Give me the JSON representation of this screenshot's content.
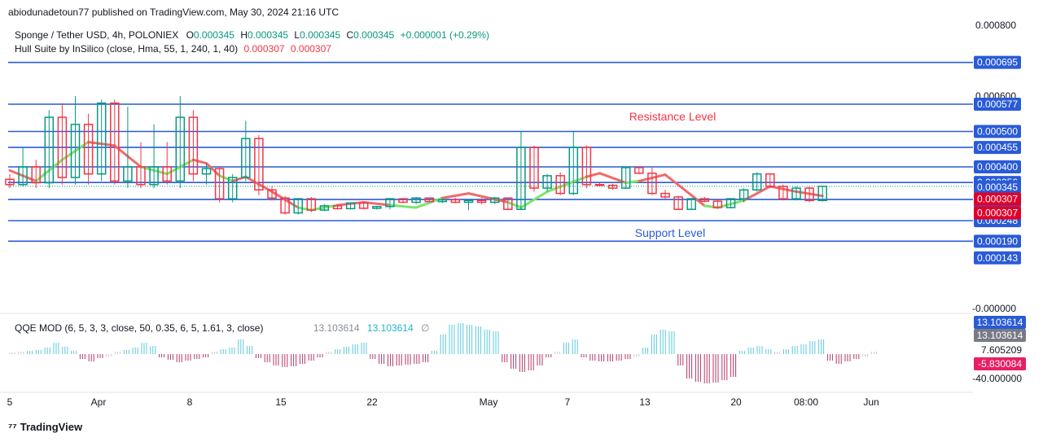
{
  "publisher": "abiodunadetoun77 published on TradingView.com, May 30, 2024 21:16 UTC",
  "legend": {
    "symbol": "Sponge / Tether USD, 4h, POLONIEX",
    "o_label": "O",
    "o_value": "0.000345",
    "h_label": "H",
    "h_value": "0.000345",
    "l_label": "L",
    "l_value": "0.000345",
    "c_label": "C",
    "c_value": "0.000345",
    "change": "+0.000001 (+0.29%)",
    "hull_label": "Hull Suite by InSilico (close, Hma, 55, 1, 240, 1, 40)",
    "hull_v1": "0.000307",
    "hull_v2": "0.000307"
  },
  "qqe_legend": {
    "label": "QQE MOD (6, 5, 3, 3, close, 50, 0.35, 6, 5, 1.61, 3, close)",
    "v1": "13.103614",
    "v2": "13.103614",
    "empty": "∅"
  },
  "annotations": {
    "resistance": "Resistance Level",
    "support": "Support Level"
  },
  "colors": {
    "up": "#089981",
    "down": "#f23645",
    "hull_up": "#7ee36b",
    "hull_down": "#f06a6a",
    "level_line": "#2a5bd7",
    "label_blue": "#2a5bd7",
    "label_red": "#e0002a",
    "qqe_up": "#5cc8de",
    "qqe_down": "#b5376b",
    "qqe_neutral": "#c8c8c8"
  },
  "brand": "TradingView",
  "chart_data": [
    {
      "type": "candlestick",
      "price_axis": {
        "ticks": [
          "0.000800",
          "0.000600",
          "-0.000000"
        ],
        "tick_values": [
          0.0008,
          0.0006,
          0.0
        ]
      },
      "levels": [
        {
          "value": 0.000695,
          "label": "0.000695"
        },
        {
          "value": 0.000577,
          "label": "0.000577"
        },
        {
          "value": 0.0005,
          "label": "0.000500"
        },
        {
          "value": 0.000455,
          "label": "0.000455"
        },
        {
          "value": 0.0004,
          "label": "0.000400"
        },
        {
          "value": 0.000356,
          "label": "0.000356"
        },
        {
          "value": 0.000308,
          "label": "0.000308"
        },
        {
          "value": 0.000248,
          "label": "0.000248"
        },
        {
          "value": 0.00019,
          "label": "0.000190"
        }
      ],
      "extra_labels": [
        {
          "value": 0.000143,
          "label": "0.000143",
          "kind": "blue"
        },
        {
          "value": 0.000345,
          "label": "0.000345",
          "kind": "blue"
        },
        {
          "value": 0.000307,
          "label": "0.000307",
          "kind": "red"
        },
        {
          "value": 0.000307,
          "label": "0.000307",
          "kind": "red"
        }
      ],
      "time_axis": {
        "labels": [
          "5",
          "Apr",
          "8",
          "15",
          "22",
          "May",
          "7",
          "13",
          "20",
          "08:00",
          "Jun"
        ],
        "x": [
          0,
          6,
          13,
          20,
          27,
          36,
          43,
          49,
          56,
          62,
          68
        ]
      },
      "candles": [
        {
          "t": 0,
          "o": 0.000365,
          "h": 0.00038,
          "l": 0.00034,
          "c": 0.00035
        },
        {
          "t": 1,
          "o": 0.00035,
          "h": 0.000455,
          "l": 0.000345,
          "c": 0.0004
        },
        {
          "t": 2,
          "o": 0.0004,
          "h": 0.00042,
          "l": 0.00034,
          "c": 0.000355
        },
        {
          "t": 3,
          "o": 0.000355,
          "h": 0.00056,
          "l": 0.00034,
          "c": 0.00054
        },
        {
          "t": 4,
          "o": 0.00054,
          "h": 0.00058,
          "l": 0.00035,
          "c": 0.00037
        },
        {
          "t": 5,
          "o": 0.00037,
          "h": 0.0006,
          "l": 0.00035,
          "c": 0.00052
        },
        {
          "t": 6,
          "o": 0.00052,
          "h": 0.00055,
          "l": 0.00035,
          "c": 0.00038
        },
        {
          "t": 7,
          "o": 0.00038,
          "h": 0.00059,
          "l": 0.00036,
          "c": 0.00058
        },
        {
          "t": 8,
          "o": 0.00058,
          "h": 0.00059,
          "l": 0.00035,
          "c": 0.00036
        },
        {
          "t": 9,
          "o": 0.00036,
          "h": 0.00057,
          "l": 0.00034,
          "c": 0.0004
        },
        {
          "t": 10,
          "o": 0.0004,
          "h": 0.00047,
          "l": 0.00034,
          "c": 0.00035
        },
        {
          "t": 11,
          "o": 0.00035,
          "h": 0.00052,
          "l": 0.00034,
          "c": 0.0004
        },
        {
          "t": 12,
          "o": 0.0004,
          "h": 0.00047,
          "l": 0.00035,
          "c": 0.00036
        },
        {
          "t": 13,
          "o": 0.00036,
          "h": 0.0006,
          "l": 0.00034,
          "c": 0.00054
        },
        {
          "t": 14,
          "o": 0.00054,
          "h": 0.00056,
          "l": 0.00036,
          "c": 0.00038
        },
        {
          "t": 15,
          "o": 0.00038,
          "h": 0.00041,
          "l": 0.00035,
          "c": 0.000395
        },
        {
          "t": 16,
          "o": 0.000395,
          "h": 0.0004,
          "l": 0.0003,
          "c": 0.00031
        },
        {
          "t": 17,
          "o": 0.00031,
          "h": 0.00038,
          "l": 0.0003,
          "c": 0.00037
        },
        {
          "t": 18,
          "o": 0.00037,
          "h": 0.00053,
          "l": 0.00036,
          "c": 0.00048
        },
        {
          "t": 19,
          "o": 0.00048,
          "h": 0.00049,
          "l": 0.00032,
          "c": 0.000335
        },
        {
          "t": 20,
          "o": 0.000335,
          "h": 0.000345,
          "l": 0.000305,
          "c": 0.000312
        },
        {
          "t": 21,
          "o": 0.000312,
          "h": 0.000318,
          "l": 0.000265,
          "c": 0.00027
        },
        {
          "t": 22,
          "o": 0.00027,
          "h": 0.000312,
          "l": 0.000265,
          "c": 0.00031
        },
        {
          "t": 23,
          "o": 0.00031,
          "h": 0.000315,
          "l": 0.000272,
          "c": 0.000278
        },
        {
          "t": 24,
          "o": 0.000278,
          "h": 0.000295,
          "l": 0.000275,
          "c": 0.00029
        },
        {
          "t": 25,
          "o": 0.00029,
          "h": 0.000295,
          "l": 0.00028,
          "c": 0.000282
        },
        {
          "t": 26,
          "o": 0.000282,
          "h": 0.0003,
          "l": 0.00028,
          "c": 0.000298
        },
        {
          "t": 27,
          "o": 0.000298,
          "h": 0.000302,
          "l": 0.00028,
          "c": 0.000283
        },
        {
          "t": 28,
          "o": 0.000283,
          "h": 0.00029,
          "l": 0.00028,
          "c": 0.000288
        },
        {
          "t": 29,
          "o": 0.000288,
          "h": 0.000312,
          "l": 0.00028,
          "c": 0.00031
        },
        {
          "t": 30,
          "o": 0.00031,
          "h": 0.000312,
          "l": 0.000298,
          "c": 0.0003
        },
        {
          "t": 31,
          "o": 0.0003,
          "h": 0.000315,
          "l": 0.000295,
          "c": 0.000312
        },
        {
          "t": 32,
          "o": 0.000312,
          "h": 0.000313,
          "l": 0.0003,
          "c": 0.000302
        },
        {
          "t": 33,
          "o": 0.000302,
          "h": 0.00031,
          "l": 0.000298,
          "c": 0.000307
        },
        {
          "t": 34,
          "o": 0.000307,
          "h": 0.000312,
          "l": 0.000298,
          "c": 0.0003
        },
        {
          "t": 35,
          "o": 0.0003,
          "h": 0.00031,
          "l": 0.000278,
          "c": 0.000305
        },
        {
          "t": 36,
          "o": 0.000305,
          "h": 0.000312,
          "l": 0.000295,
          "c": 0.0003
        },
        {
          "t": 37,
          "o": 0.0003,
          "h": 0.000315,
          "l": 0.000295,
          "c": 0.000312
        },
        {
          "t": 38,
          "o": 0.000312,
          "h": 0.000314,
          "l": 0.000278,
          "c": 0.00028
        },
        {
          "t": 39,
          "o": 0.00028,
          "h": 0.0005,
          "l": 0.000278,
          "c": 0.000455
        },
        {
          "t": 40,
          "o": 0.000455,
          "h": 0.00046,
          "l": 0.00033,
          "c": 0.00034
        },
        {
          "t": 41,
          "o": 0.00034,
          "h": 0.00038,
          "l": 0.00033,
          "c": 0.000375
        },
        {
          "t": 42,
          "o": 0.000375,
          "h": 0.000385,
          "l": 0.00032,
          "c": 0.000325
        },
        {
          "t": 43,
          "o": 0.000325,
          "h": 0.0005,
          "l": 0.00032,
          "c": 0.000455
        },
        {
          "t": 44,
          "o": 0.000455,
          "h": 0.00046,
          "l": 0.00034,
          "c": 0.00035
        },
        {
          "t": 45,
          "o": 0.00035,
          "h": 0.000355,
          "l": 0.000345,
          "c": 0.000348
        },
        {
          "t": 46,
          "o": 0.000348,
          "h": 0.000352,
          "l": 0.000335,
          "c": 0.00034
        },
        {
          "t": 47,
          "o": 0.00034,
          "h": 0.0004,
          "l": 0.000338,
          "c": 0.000398
        },
        {
          "t": 48,
          "o": 0.000398,
          "h": 0.0004,
          "l": 0.00038,
          "c": 0.000382
        },
        {
          "t": 49,
          "o": 0.000382,
          "h": 0.000398,
          "l": 0.00032,
          "c": 0.000325
        },
        {
          "t": 50,
          "o": 0.000325,
          "h": 0.000335,
          "l": 0.00031,
          "c": 0.000315
        },
        {
          "t": 51,
          "o": 0.000315,
          "h": 0.000318,
          "l": 0.000278,
          "c": 0.00028
        },
        {
          "t": 52,
          "o": 0.00028,
          "h": 0.000312,
          "l": 0.000278,
          "c": 0.00031
        },
        {
          "t": 53,
          "o": 0.00031,
          "h": 0.000315,
          "l": 0.0003,
          "c": 0.000303
        },
        {
          "t": 54,
          "o": 0.000303,
          "h": 0.00031,
          "l": 0.000282,
          "c": 0.000285
        },
        {
          "t": 55,
          "o": 0.000285,
          "h": 0.000312,
          "l": 0.000283,
          "c": 0.00031
        },
        {
          "t": 56,
          "o": 0.00031,
          "h": 0.00034,
          "l": 0.0003,
          "c": 0.000335
        },
        {
          "t": 57,
          "o": 0.000335,
          "h": 0.000385,
          "l": 0.00033,
          "c": 0.00038
        },
        {
          "t": 58,
          "o": 0.00038,
          "h": 0.000382,
          "l": 0.00034,
          "c": 0.000345
        },
        {
          "t": 59,
          "o": 0.000345,
          "h": 0.00035,
          "l": 0.000305,
          "c": 0.00031
        },
        {
          "t": 60,
          "o": 0.00031,
          "h": 0.000345,
          "l": 0.000305,
          "c": 0.00034
        },
        {
          "t": 61,
          "o": 0.00034,
          "h": 0.000345,
          "l": 0.0003,
          "c": 0.000305
        },
        {
          "t": 62,
          "o": 0.000305,
          "h": 0.000345,
          "l": 0.000302,
          "c": 0.000345
        }
      ],
      "hull_line": [
        {
          "t": 0,
          "v": 0.00039,
          "trend": "down"
        },
        {
          "t": 2,
          "v": 0.00036,
          "trend": "down"
        },
        {
          "t": 4,
          "v": 0.00042,
          "trend": "up"
        },
        {
          "t": 6,
          "v": 0.00047,
          "trend": "up"
        },
        {
          "t": 8,
          "v": 0.00046,
          "trend": "down"
        },
        {
          "t": 10,
          "v": 0.0004,
          "trend": "down"
        },
        {
          "t": 12,
          "v": 0.00038,
          "trend": "up"
        },
        {
          "t": 14,
          "v": 0.00042,
          "trend": "up"
        },
        {
          "t": 15,
          "v": 0.00041,
          "trend": "down"
        },
        {
          "t": 16,
          "v": 0.000375,
          "trend": "down"
        },
        {
          "t": 17,
          "v": 0.00036,
          "trend": "up"
        },
        {
          "t": 18,
          "v": 0.000372,
          "trend": "down"
        },
        {
          "t": 20,
          "v": 0.00033,
          "trend": "down"
        },
        {
          "t": 22,
          "v": 0.000285,
          "trend": "down"
        },
        {
          "t": 23,
          "v": 0.000278,
          "trend": "up"
        },
        {
          "t": 25,
          "v": 0.000292,
          "trend": "up"
        },
        {
          "t": 27,
          "v": 0.0003,
          "trend": "down"
        },
        {
          "t": 29,
          "v": 0.000292,
          "trend": "down"
        },
        {
          "t": 31,
          "v": 0.000285,
          "trend": "up"
        },
        {
          "t": 33,
          "v": 0.000312,
          "trend": "up"
        },
        {
          "t": 35,
          "v": 0.000325,
          "trend": "down"
        },
        {
          "t": 38,
          "v": 0.0003,
          "trend": "down"
        },
        {
          "t": 39,
          "v": 0.000285,
          "trend": "up"
        },
        {
          "t": 41,
          "v": 0.00033,
          "trend": "up"
        },
        {
          "t": 44,
          "v": 0.000372,
          "trend": "up"
        },
        {
          "t": 45,
          "v": 0.000382,
          "trend": "down"
        },
        {
          "t": 47,
          "v": 0.000355,
          "trend": "down"
        },
        {
          "t": 48,
          "v": 0.00036,
          "trend": "up"
        },
        {
          "t": 50,
          "v": 0.000378,
          "trend": "down"
        },
        {
          "t": 52,
          "v": 0.00032,
          "trend": "down"
        },
        {
          "t": 53,
          "v": 0.00029,
          "trend": "down"
        },
        {
          "t": 54,
          "v": 0.000285,
          "trend": "up"
        },
        {
          "t": 56,
          "v": 0.000305,
          "trend": "up"
        },
        {
          "t": 58,
          "v": 0.000345,
          "trend": "down"
        },
        {
          "t": 60,
          "v": 0.00033,
          "trend": "down"
        },
        {
          "t": 62,
          "v": 0.000318,
          "trend": "down"
        }
      ]
    },
    {
      "type": "bar",
      "name": "QQE MOD",
      "y_ticks": [
        "13.103614",
        "13.103614",
        "7.605209",
        "-5.830084",
        "-40.000000"
      ],
      "tick_kinds": [
        "blue",
        "gray",
        "plain",
        "red",
        "plain"
      ],
      "values": [
        2,
        3,
        4,
        5,
        8,
        14,
        9,
        4,
        -6,
        -9,
        -5,
        -3,
        3,
        5,
        8,
        14,
        10,
        -4,
        -7,
        -10,
        -8,
        -6,
        -4,
        3,
        6,
        8,
        18,
        10,
        -5,
        -10,
        -14,
        -16,
        -15,
        -12,
        -8,
        -4,
        3,
        6,
        9,
        12,
        14,
        -6,
        -12,
        -15,
        -14,
        -13,
        -12,
        -10,
        4,
        24,
        36,
        38,
        36,
        34,
        30,
        28,
        -10,
        -18,
        -22,
        -20,
        -14,
        -4,
        3,
        14,
        18,
        -4,
        -8,
        -9,
        -9,
        -8,
        -6,
        -3,
        8,
        24,
        30,
        28,
        -14,
        -30,
        -34,
        -36,
        -35,
        -32,
        -28,
        4,
        8,
        10,
        6,
        3,
        6,
        10,
        12,
        16,
        18,
        -8,
        -12,
        -9,
        -6,
        -3,
        3
      ]
    }
  ]
}
